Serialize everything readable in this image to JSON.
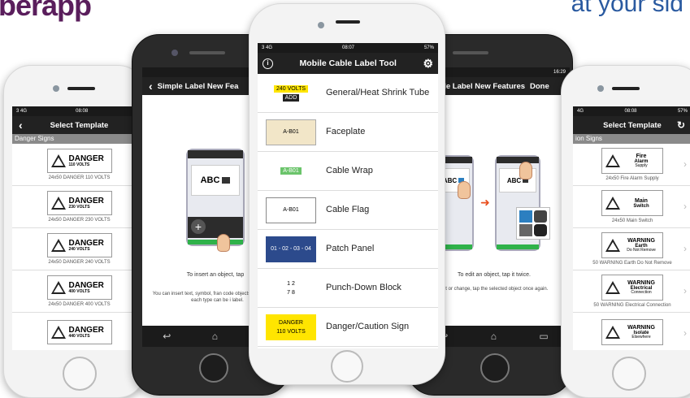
{
  "header": {
    "left": "berapp",
    "right": "at your sid"
  },
  "p1": {
    "status_left": "3  4G",
    "status_time": "08:08",
    "status_right": "57",
    "title": "Select Template",
    "section": "Danger Signs",
    "items": [
      {
        "word": "DANGER",
        "sub": "110 VOLTS",
        "caption": "24x50 DANGER 110 VOLTS"
      },
      {
        "word": "DANGER",
        "sub": "230 VOLTS",
        "caption": "24x50 DANGER 230 VOLTS"
      },
      {
        "word": "DANGER",
        "sub": "240 VOLTS",
        "caption": "24x50 DANGER 240 VOLTS"
      },
      {
        "word": "DANGER",
        "sub": "400 VOLTS",
        "caption": "24x50 DANGER 400 VOLTS"
      },
      {
        "word": "DANGER",
        "sub": "440 VOLTS",
        "caption": ""
      }
    ]
  },
  "p2": {
    "title": "Simple Label New Fea",
    "card_label": "ABC",
    "insert_text": "To insert an object, tap",
    "body_text": "You can insert text, symbol, fran code objects. One object of each type can be i label.",
    "dots": "• • •"
  },
  "p3": {
    "status_left": "3  4G",
    "status_time": "08:07",
    "status_right": "57%",
    "title": "Mobile Cable Label Tool",
    "items": [
      {
        "label": "General/Heat Shrink Tube",
        "icon_top": "240 VOLTS",
        "icon_bottom": "ADD"
      },
      {
        "label": "Faceplate",
        "icon_top": "A-B01"
      },
      {
        "label": "Cable Wrap",
        "icon_top": "A-B01"
      },
      {
        "label": "Cable Flag",
        "icon_top": "A-B01"
      },
      {
        "label": "Patch Panel",
        "icon_top": "01 - 02 - 03 - 04"
      },
      {
        "label": "Punch-Down Block",
        "icon_top": "1   2",
        "icon_bottom": "7   8"
      },
      {
        "label": "Danger/Caution Sign",
        "icon_top": "DANGER",
        "icon_bottom": "110 VOLTS"
      }
    ]
  },
  "p4": {
    "status_time": "16:29",
    "title": "Simple Label New Features",
    "done": "Done",
    "card_a": "ABC",
    "card_b": "ABC",
    "edit_text": "To edit an object, tap it twice.",
    "body_text": "dit or change, tap the selected object once again.",
    "dots": "• • •"
  },
  "p5": {
    "status_left": "4G",
    "status_time": "08:08",
    "status_right": "57%",
    "title": "Select Template",
    "section": "ion Signs",
    "items": [
      {
        "l1": "Fire",
        "l2": "Alarm",
        "l3": "Supply",
        "caption": "24x50 Fire Alarm Supply"
      },
      {
        "l1": "Main",
        "l2": "Switch",
        "l3": "",
        "caption": "24x50 Main Switch"
      },
      {
        "l1": "WARNING",
        "l2": "Earth",
        "l3": "Do Not Remove",
        "caption": "50 WARNING Earth Do Not Remove"
      },
      {
        "l1": "WARNING",
        "l2": "Electrical",
        "l3": "Connection",
        "caption": "50 WARNING Electrical Connection"
      },
      {
        "l1": "WARNING",
        "l2": "Isolate",
        "l3": "Elsewhere",
        "caption": ""
      }
    ]
  }
}
